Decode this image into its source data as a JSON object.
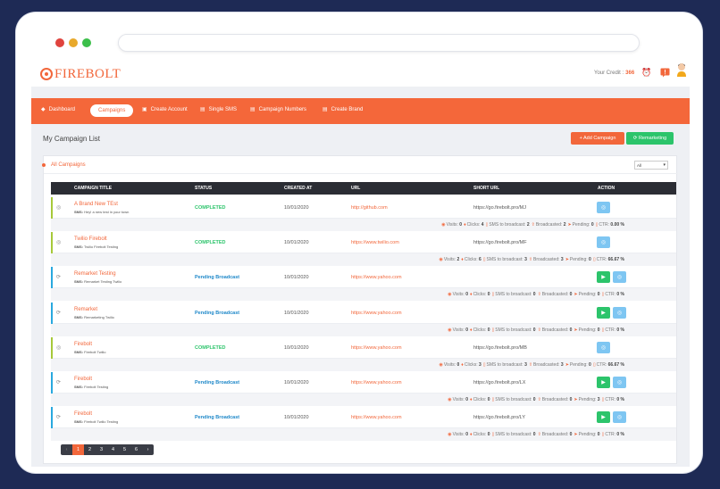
{
  "header": {
    "logo_text": "FIREBOLT",
    "credit_label": "Your Credit :",
    "credit_value": "366"
  },
  "nav": {
    "items": [
      {
        "label": "Dashboard",
        "icon": "tachometer-icon"
      },
      {
        "label": "Campaigns",
        "icon": "",
        "active": true
      },
      {
        "label": "Create Account",
        "icon": "user-plus-icon"
      },
      {
        "label": "Single SMS",
        "icon": "chat-icon"
      },
      {
        "label": "Campaign Numbers",
        "icon": "list-icon"
      },
      {
        "label": "Create Brand",
        "icon": "tag-icon"
      }
    ]
  },
  "page": {
    "title": "My Campaign List",
    "add_campaign": "+ Add Campaign",
    "remarketing": "⟳ Remarketing"
  },
  "card": {
    "title": "All Campaigns",
    "filter_value": "All"
  },
  "table": {
    "headers": [
      "CAMPAIGN TITLE",
      "STATUS",
      "CREATED AT",
      "URL",
      "SHORT URL",
      "ACTION"
    ],
    "rows": [
      {
        "title": "A Brand New TEst",
        "sms_label": "SMS:",
        "sms": "Hey! a new test in your town",
        "status": "COMPLETED",
        "created": "10/01/2020",
        "url": "http://github.com",
        "short": "https://go.firebolt.pro/MJ",
        "visits": "0",
        "clicks": "4",
        "broadcast": "2",
        "broadcasted": "2",
        "pending": "0",
        "ctr": "0.00 %"
      },
      {
        "title": "Twilio Firebolt",
        "sms_label": "SMS:",
        "sms": "Twilio Firebolt Testing",
        "status": "COMPLETED",
        "created": "10/01/2020",
        "url": "https://www.twilio.com",
        "short": "https://go.firebolt.pro/MF",
        "visits": "2",
        "clicks": "6",
        "broadcast": "3",
        "broadcasted": "3",
        "pending": "0",
        "ctr": "66.67 %"
      },
      {
        "title": "Remarket Testing",
        "sms_label": "SMS:",
        "sms": "Remarket Testing Twilio",
        "status": "Pending Broadcast",
        "created": "10/01/2020",
        "url": "https://www.yahoo.com",
        "short": "",
        "visits": "0",
        "clicks": "0",
        "broadcast": "0",
        "broadcasted": "0",
        "pending": "0",
        "ctr": "0 %"
      },
      {
        "title": "Remarket",
        "sms_label": "SMS:",
        "sms": "Remarketing Twilio",
        "status": "Pending Broadcast",
        "created": "10/01/2020",
        "url": "https://www.yahoo.com",
        "short": "",
        "visits": "0",
        "clicks": "0",
        "broadcast": "0",
        "broadcasted": "0",
        "pending": "0",
        "ctr": "0 %"
      },
      {
        "title": "Firebolt",
        "sms_label": "SMS:",
        "sms": "Firebolt Twilio",
        "status": "COMPLETED",
        "created": "10/01/2020",
        "url": "https://www.yahoo.com",
        "short": "https://go.firebolt.pro/MB",
        "visits": "0",
        "clicks": "3",
        "broadcast": "3",
        "broadcasted": "3",
        "pending": "0",
        "ctr": "66.67 %"
      },
      {
        "title": "Firebolt",
        "sms_label": "SMS:",
        "sms": "Firebolt Testing",
        "status": "Pending Broadcast",
        "created": "10/01/2020",
        "url": "https://www.yahoo.com",
        "short": "https://go.firebolt.pro/LX",
        "visits": "0",
        "clicks": "0",
        "broadcast": "0",
        "broadcasted": "0",
        "pending": "3",
        "ctr": "0 %"
      },
      {
        "title": "Firebolt",
        "sms_label": "SMS:",
        "sms": "Firebolt Twilio Testing",
        "status": "Pending Broadcast",
        "created": "10/01/2020",
        "url": "https://www.yahoo.com",
        "short": "https://go.firebolt.pro/LY",
        "visits": "0",
        "clicks": "0",
        "broadcast": "0",
        "broadcasted": "0",
        "pending": "0",
        "ctr": "0 %"
      }
    ],
    "stat_labels": {
      "visits": "Visits:",
      "clicks": "Clicks:",
      "broadcast": "SMS to broadcast:",
      "broadcasted": "Broadcasted:",
      "pending": "Pending:",
      "ctr": "CTR:"
    }
  },
  "pagination": [
    "‹",
    "1",
    "2",
    "3",
    "4",
    "5",
    "6",
    "›"
  ],
  "colors": {
    "brand": "#f4673a",
    "completed": "#2cc46b",
    "pending": "#1e88c9",
    "bar_completed": "#a6c93a",
    "bar_pending": "#29a8df"
  }
}
